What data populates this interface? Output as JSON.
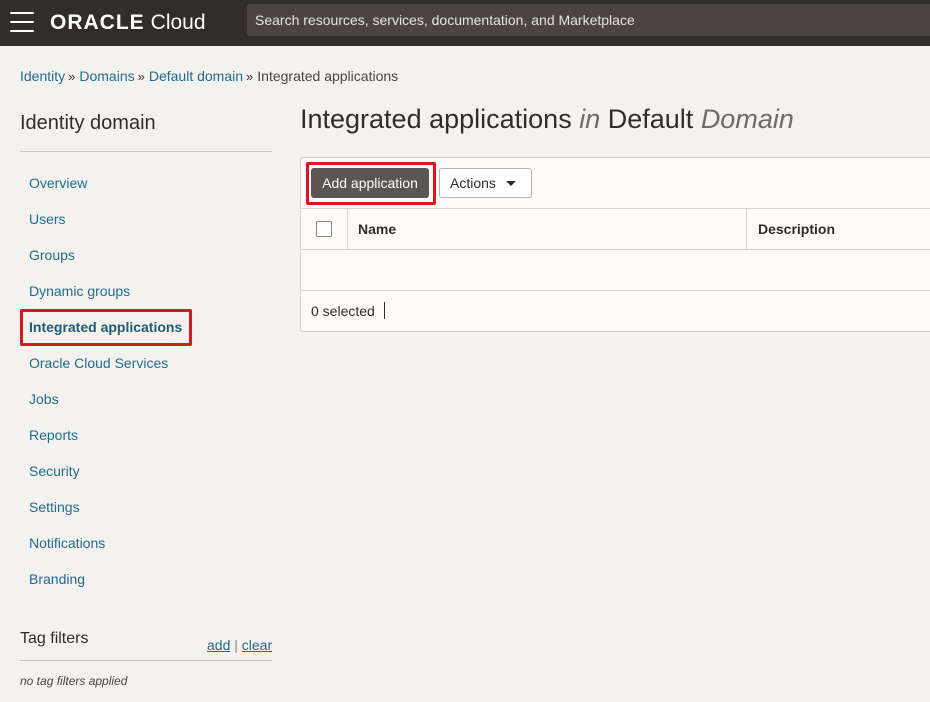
{
  "header": {
    "brand_oracle": "ORACLE",
    "brand_cloud": "Cloud",
    "search_placeholder": "Search resources, services, documentation, and Marketplace"
  },
  "breadcrumb": {
    "items": [
      "Identity",
      "Domains",
      "Default domain"
    ],
    "current": "Integrated applications",
    "separator": "»"
  },
  "sidebar": {
    "title": "Identity domain",
    "items": [
      {
        "label": "Overview"
      },
      {
        "label": "Users"
      },
      {
        "label": "Groups"
      },
      {
        "label": "Dynamic groups"
      },
      {
        "label": "Integrated applications"
      },
      {
        "label": "Oracle Cloud Services"
      },
      {
        "label": "Jobs"
      },
      {
        "label": "Reports"
      },
      {
        "label": "Security"
      },
      {
        "label": "Settings"
      },
      {
        "label": "Notifications"
      },
      {
        "label": "Branding"
      }
    ],
    "active_index": 4,
    "tag_filters": {
      "title": "Tag filters",
      "add_label": "add",
      "divider": "|",
      "clear_label": "clear",
      "empty_text": "no tag filters applied"
    }
  },
  "main": {
    "title_part1": "Integrated applications",
    "title_in": "in",
    "title_part2": "Default",
    "title_domain": "Domain",
    "toolbar": {
      "add_label": "Add application",
      "actions_label": "Actions"
    },
    "table": {
      "columns": [
        "Name",
        "Description"
      ],
      "rows": []
    },
    "selected_text": "0 selected"
  },
  "colors": {
    "header_bg": "#312d2a",
    "link": "#1f6c8f",
    "highlight": "#e0141e",
    "primary_button": "#5b5652"
  }
}
